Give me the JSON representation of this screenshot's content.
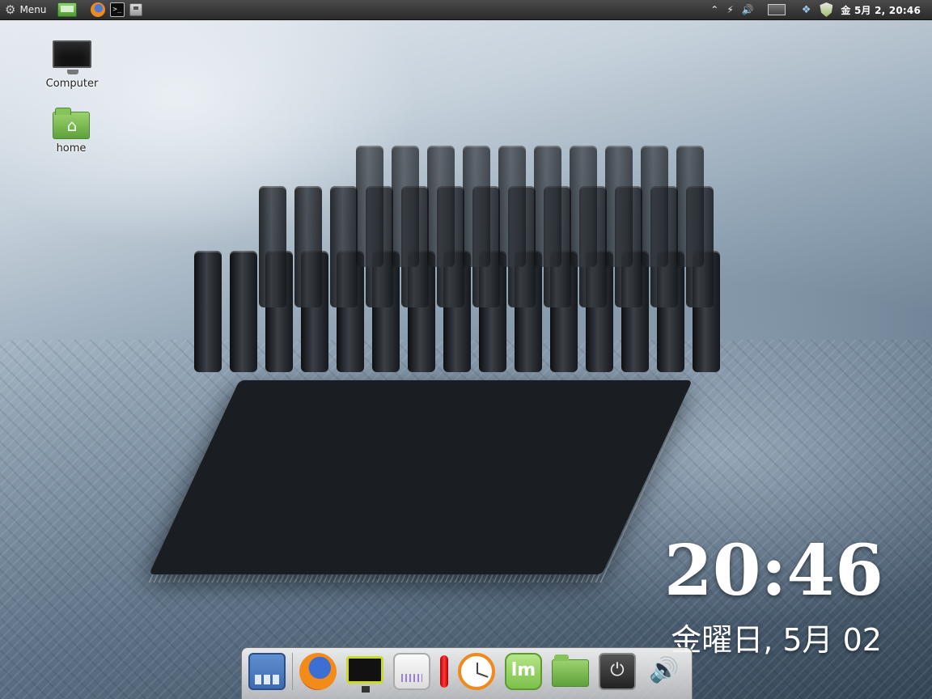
{
  "top_panel": {
    "menu_label": "Menu",
    "launchers": [
      "show-desktop",
      "firefox",
      "terminal",
      "file-manager"
    ],
    "tray_icons": [
      "chevron-up-icon",
      "network-icon",
      "volume-icon",
      "display-icon",
      "dropbox-icon",
      "shield-icon"
    ],
    "clock": "金 5月 2, 20:46"
  },
  "desktop": {
    "icons": [
      {
        "label": "Computer",
        "icon": "monitor-icon"
      },
      {
        "label": "home",
        "icon": "home-folder-icon"
      }
    ]
  },
  "desklet": {
    "time": "20:46",
    "date": "金曜日, 5月 02"
  },
  "dock": {
    "items": [
      "show-desktop",
      "firefox",
      "system-monitor",
      "system-load",
      "temperature",
      "clock",
      "linux-mint-menu",
      "files",
      "power",
      "volume"
    ],
    "power_glyph": "⏻",
    "volume_glyph": "🔊",
    "mint_glyph": "lm"
  },
  "colors": {
    "panel": "#2b2b2b",
    "accent_green": "#7cc04a",
    "firefox_orange": "#f08a1c"
  }
}
